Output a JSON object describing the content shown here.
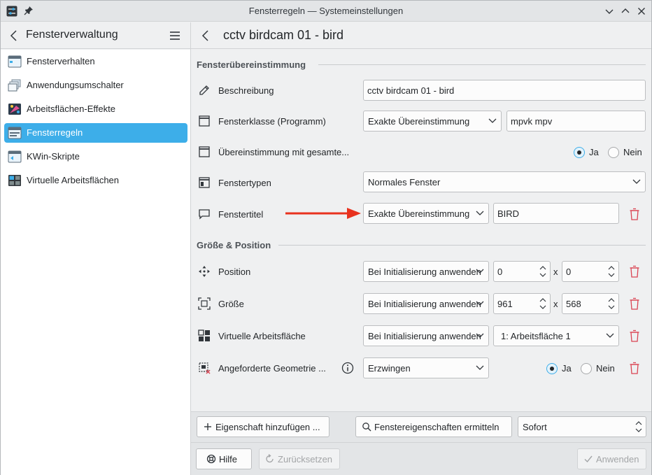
{
  "window": {
    "title": "Fensterregeln — Systemeinstellungen"
  },
  "left_header": {
    "title": "Fensterverwaltung"
  },
  "sidebar": {
    "items": [
      {
        "label": "Fensterverhalten",
        "icon": "window-behavior-icon"
      },
      {
        "label": "Anwendungsumschalter",
        "icon": "task-switcher-icon"
      },
      {
        "label": "Arbeitsflächen-Effekte",
        "icon": "desktop-effects-icon"
      },
      {
        "label": "Fensterregeln",
        "icon": "window-rules-icon",
        "selected": true
      },
      {
        "label": "KWin-Skripte",
        "icon": "kwin-scripts-icon"
      },
      {
        "label": "Virtuelle Arbeitsflächen",
        "icon": "virtual-desktops-icon"
      }
    ]
  },
  "page": {
    "title": "cctv birdcam 01 - bird"
  },
  "sections": {
    "match": "Fensterübereinstimmung",
    "size_position": "Größe & Position"
  },
  "rows": {
    "description": {
      "label": "Beschreibung",
      "value": "cctv birdcam 01 - bird"
    },
    "window_class": {
      "label": "Fensterklasse (Programm)",
      "match": "Exakte Übereinstimmung",
      "value": "mpvk mpv"
    },
    "whole_class": {
      "label": "Übereinstimmung mit gesamte...",
      "yes": "Ja",
      "no": "Nein",
      "selected": "Ja"
    },
    "window_types": {
      "label": "Fenstertypen",
      "value": "Normales Fenster"
    },
    "window_title": {
      "label": "Fenstertitel",
      "match": "Exakte Übereinstimmung",
      "value": "BIRD"
    },
    "position": {
      "label": "Position",
      "policy": "Bei Initialisierung anwenden",
      "x": "0",
      "y": "0"
    },
    "size": {
      "label": "Größe",
      "policy": "Bei Initialisierung anwenden",
      "w": "961",
      "h": "568"
    },
    "desktop": {
      "label": "Virtuelle Arbeitsfläche",
      "policy": "Bei Initialisierung anwenden",
      "value": "1: Arbeitsfläche 1"
    },
    "geometry": {
      "label": "Angeforderte Geometrie ...",
      "policy": "Erzwingen",
      "yes": "Ja",
      "no": "Nein",
      "selected": "Ja"
    }
  },
  "times_sign": "x",
  "bottom": {
    "add_property": "Eigenschaft hinzufügen ...",
    "detect": "Fenstereigenschaften ermitteln",
    "delay": "Sofort"
  },
  "dialog": {
    "help": "Hilfe",
    "reset": "Zurücksetzen",
    "apply": "Anwenden"
  },
  "colors": {
    "accent": "#3daee9",
    "annotation_arrow": "#e8321e",
    "trash": "#da4453"
  }
}
